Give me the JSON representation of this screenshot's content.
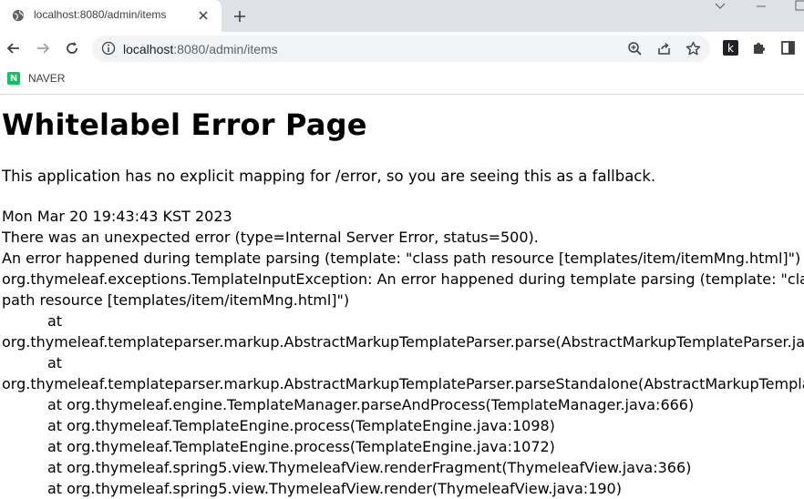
{
  "browser": {
    "tab": {
      "title": "localhost:8080/admin/items"
    },
    "url": {
      "host": "localhost",
      "rest": ":8080/admin/items"
    },
    "bookmarks": [
      {
        "label": "NAVER",
        "icon": "naver-icon"
      }
    ],
    "extension_letter": "k"
  },
  "page": {
    "title": "Whitelabel Error Page",
    "description": "This application has no explicit mapping for /error, so you are seeing this as a fallback.",
    "lines": [
      "Mon Mar 20 19:43:43 KST 2023",
      "There was an unexpected error (type=Internal Server Error, status=500).",
      "An error happened during template parsing (template: \"class path resource [templates/item/itemMng.html]\")",
      "org.thymeleaf.exceptions.TemplateInputException: An error happened during template parsing (template: \"class",
      "path resource [templates/item/itemMng.html]\")",
      "at",
      "org.thymeleaf.templateparser.markup.AbstractMarkupTemplateParser.parse(AbstractMarkupTemplateParser.java:",
      "at",
      "org.thymeleaf.templateparser.markup.AbstractMarkupTemplateParser.parseStandalone(AbstractMarkupTemplate",
      "at org.thymeleaf.engine.TemplateManager.parseAndProcess(TemplateManager.java:666)",
      "at org.thymeleaf.TemplateEngine.process(TemplateEngine.java:1098)",
      "at org.thymeleaf.TemplateEngine.process(TemplateEngine.java:1072)",
      "at org.thymeleaf.spring5.view.ThymeleafView.renderFragment(ThymeleafView.java:366)",
      "at org.thymeleaf.spring5.view.ThymeleafView.render(ThymeleafView.java:190)"
    ]
  },
  "colors": {
    "tabstrip": "#dee1e6",
    "omnibox": "#f1f3f4",
    "naver": "#03c75a"
  }
}
